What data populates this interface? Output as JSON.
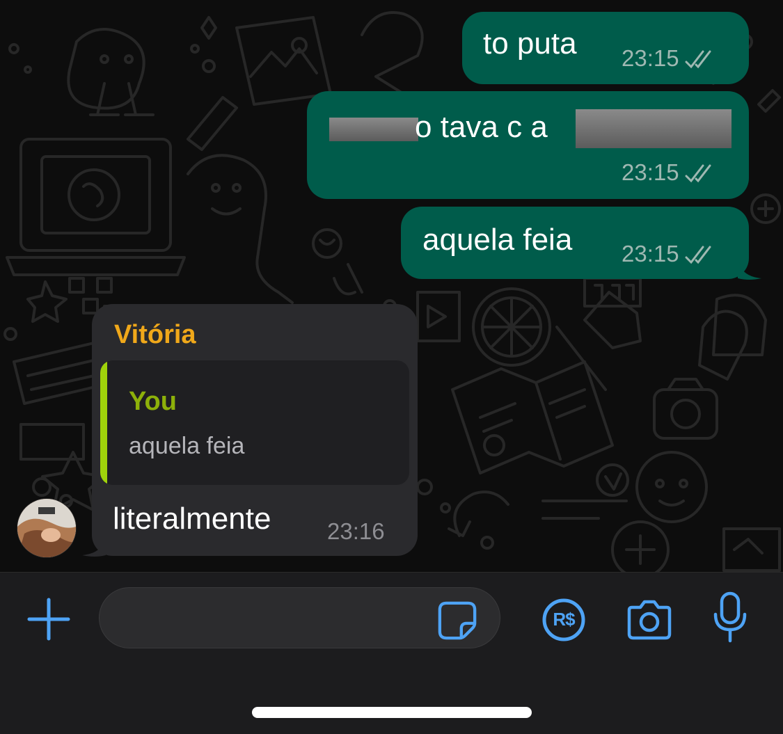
{
  "colors": {
    "outgoing_bubble": "#005c4b",
    "incoming_bubble": "#2a2a2d",
    "accent_blue": "#4ea3f5",
    "sender_name": "#f0a81a",
    "quote_author": "#8db10a",
    "quote_bar": "#9fd20b"
  },
  "messages": {
    "m1": {
      "text": "to puta",
      "time": "23:15",
      "status": "read-ticks"
    },
    "m2": {
      "text": "o tava c a",
      "time": "23:15",
      "status": "read-ticks"
    },
    "m3": {
      "text": "aquela feia",
      "time": "23:15",
      "status": "read-ticks"
    },
    "m4": {
      "sender": "Vitória",
      "quote": {
        "author": "You",
        "text": "aquela feia"
      },
      "text": "literalmente",
      "time": "23:16"
    }
  },
  "composer": {
    "input_value": "",
    "icons": [
      "plus-icon",
      "sticker-icon",
      "payment-icon",
      "camera-icon",
      "microphone-icon"
    ],
    "payment_symbol": "R$"
  }
}
